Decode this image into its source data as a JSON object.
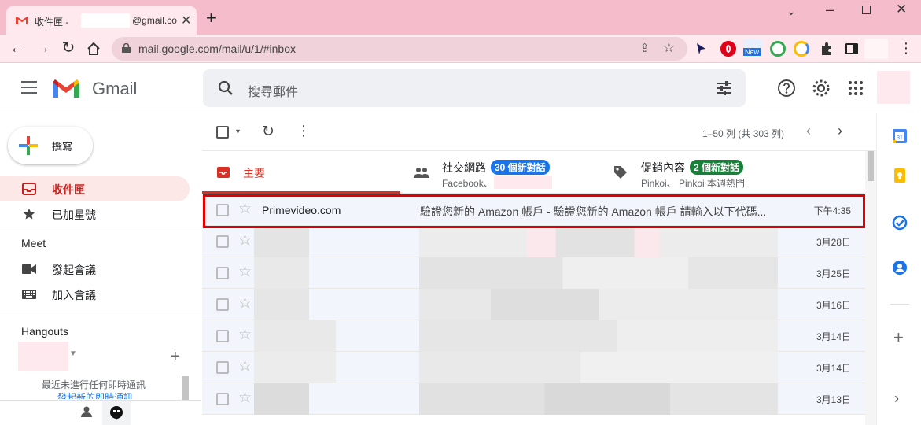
{
  "browser": {
    "tab_title": "收件匣 -",
    "tab_title_suffix": "@gmail.co",
    "url": "mail.google.com/mail/u/1/#inbox",
    "ext_new_label": "New"
  },
  "app": {
    "name": "Gmail",
    "search_placeholder": "搜尋郵件"
  },
  "sidebar": {
    "compose_label": "撰寫",
    "items": [
      {
        "label": "收件匣",
        "icon": "inbox-icon",
        "active": true
      },
      {
        "label": "已加星號",
        "icon": "star-icon",
        "active": false
      }
    ],
    "meet_header": "Meet",
    "meet_items": [
      {
        "label": "發起會議",
        "icon": "video-icon"
      },
      {
        "label": "加入會議",
        "icon": "keyboard-icon"
      }
    ],
    "hangouts_header": "Hangouts",
    "hangouts_empty": "最近未進行任何即時通訊",
    "hangouts_link": "發起新的即時通訊"
  },
  "toolbar": {
    "pagination": "1–50 列 (共 303 列)"
  },
  "categories": [
    {
      "title": "主要",
      "icon": "inbox-icon",
      "color": "#d93025"
    },
    {
      "title": "社交網路",
      "badge": "30 個新對話",
      "badge_color": "#1a73e8",
      "sub": "Facebook、",
      "icon": "people-icon"
    },
    {
      "title": "促銷內容",
      "badge": "2 個新對話",
      "badge_color": "#188038",
      "sub": "Pinkoi、 Pinkoi 本週熱門",
      "icon": "tag-icon"
    }
  ],
  "emails": [
    {
      "sender": "Primevideo.com",
      "subject": "驗證您新的 Amazon 帳戶 - 驗證您新的 Amazon 帳戶 請輸入以下代碼...",
      "date": "下午4:35"
    },
    {
      "sender": "",
      "subject": "",
      "date": "3月28日"
    },
    {
      "sender": "",
      "subject": "",
      "date": "3月25日"
    },
    {
      "sender": "",
      "subject": "",
      "date": "3月16日"
    },
    {
      "sender": "",
      "subject": "",
      "date": "3月14日"
    },
    {
      "sender": "",
      "subject": "",
      "date": "3月14日"
    },
    {
      "sender": "",
      "subject": "",
      "date": "3月13日"
    }
  ],
  "colors": {
    "browser_frame": "#f5bdcc",
    "highlight": "#e00000",
    "active_item_bg": "#fce8e6",
    "primary_red": "#d93025"
  }
}
